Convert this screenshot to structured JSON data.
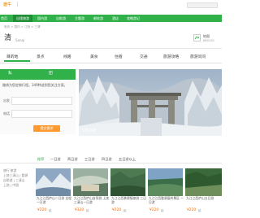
{
  "header": {
    "logo_text": "途牛",
    "nav": [
      "首页",
      "出境旅游",
      "国内游",
      "自助游",
      "主题游",
      "邮轮游",
      "酒店",
      "攻略游记"
    ],
    "active_index": 1
  },
  "titlerow": {
    "breadcrumb": "首页 > 国内 > 江西 > 三清",
    "title": "清",
    "subtitle": "Sanqi",
    "right_label": "地图",
    "right_value": "680120"
  },
  "tabs": [
    "目的地",
    "景点",
    "线路",
    "美食",
    "住宿",
    "交通",
    "旅游攻略",
    "旅游问问"
  ],
  "left_panel": {
    "title_left": "私",
    "title_right": "团",
    "intro": "路线为您定制行程。349种送到您关注方案。",
    "field1_label": "出发",
    "field2_label": "电话",
    "button": "提交需求"
  },
  "photo": {
    "caption": "三清山风景"
  },
  "days": [
    "推荐",
    "一日游",
    "两日游",
    "三日游",
    "四日游",
    "五日游以上"
  ],
  "left_bottom": [
    "旅行·旅游",
    "上饶三清山 | 婺源",
    "自助游 | 三清山",
    "上饶 | 中国"
  ],
  "cards": [
    {
      "title": "九江江西庐山二日游 全程一日游",
      "price": "¥220",
      "tag": "起"
    },
    {
      "title": "九江江西庐山自驾游 上饶三清山一日游",
      "price": "¥320",
      "tag": "起"
    },
    {
      "title": "九江江西景德镇旅游 三日游",
      "price": "¥220",
      "tag": "起"
    },
    {
      "title": "九江江西婺源篁岭景区 一日游",
      "price": "¥220",
      "tag": "起"
    },
    {
      "title": "九江江西庐山五日游",
      "price": "¥220",
      "tag": "起"
    }
  ],
  "colors": {
    "brand": "#30b14a",
    "accent": "#ff9a2e",
    "price": "#ff6600"
  }
}
